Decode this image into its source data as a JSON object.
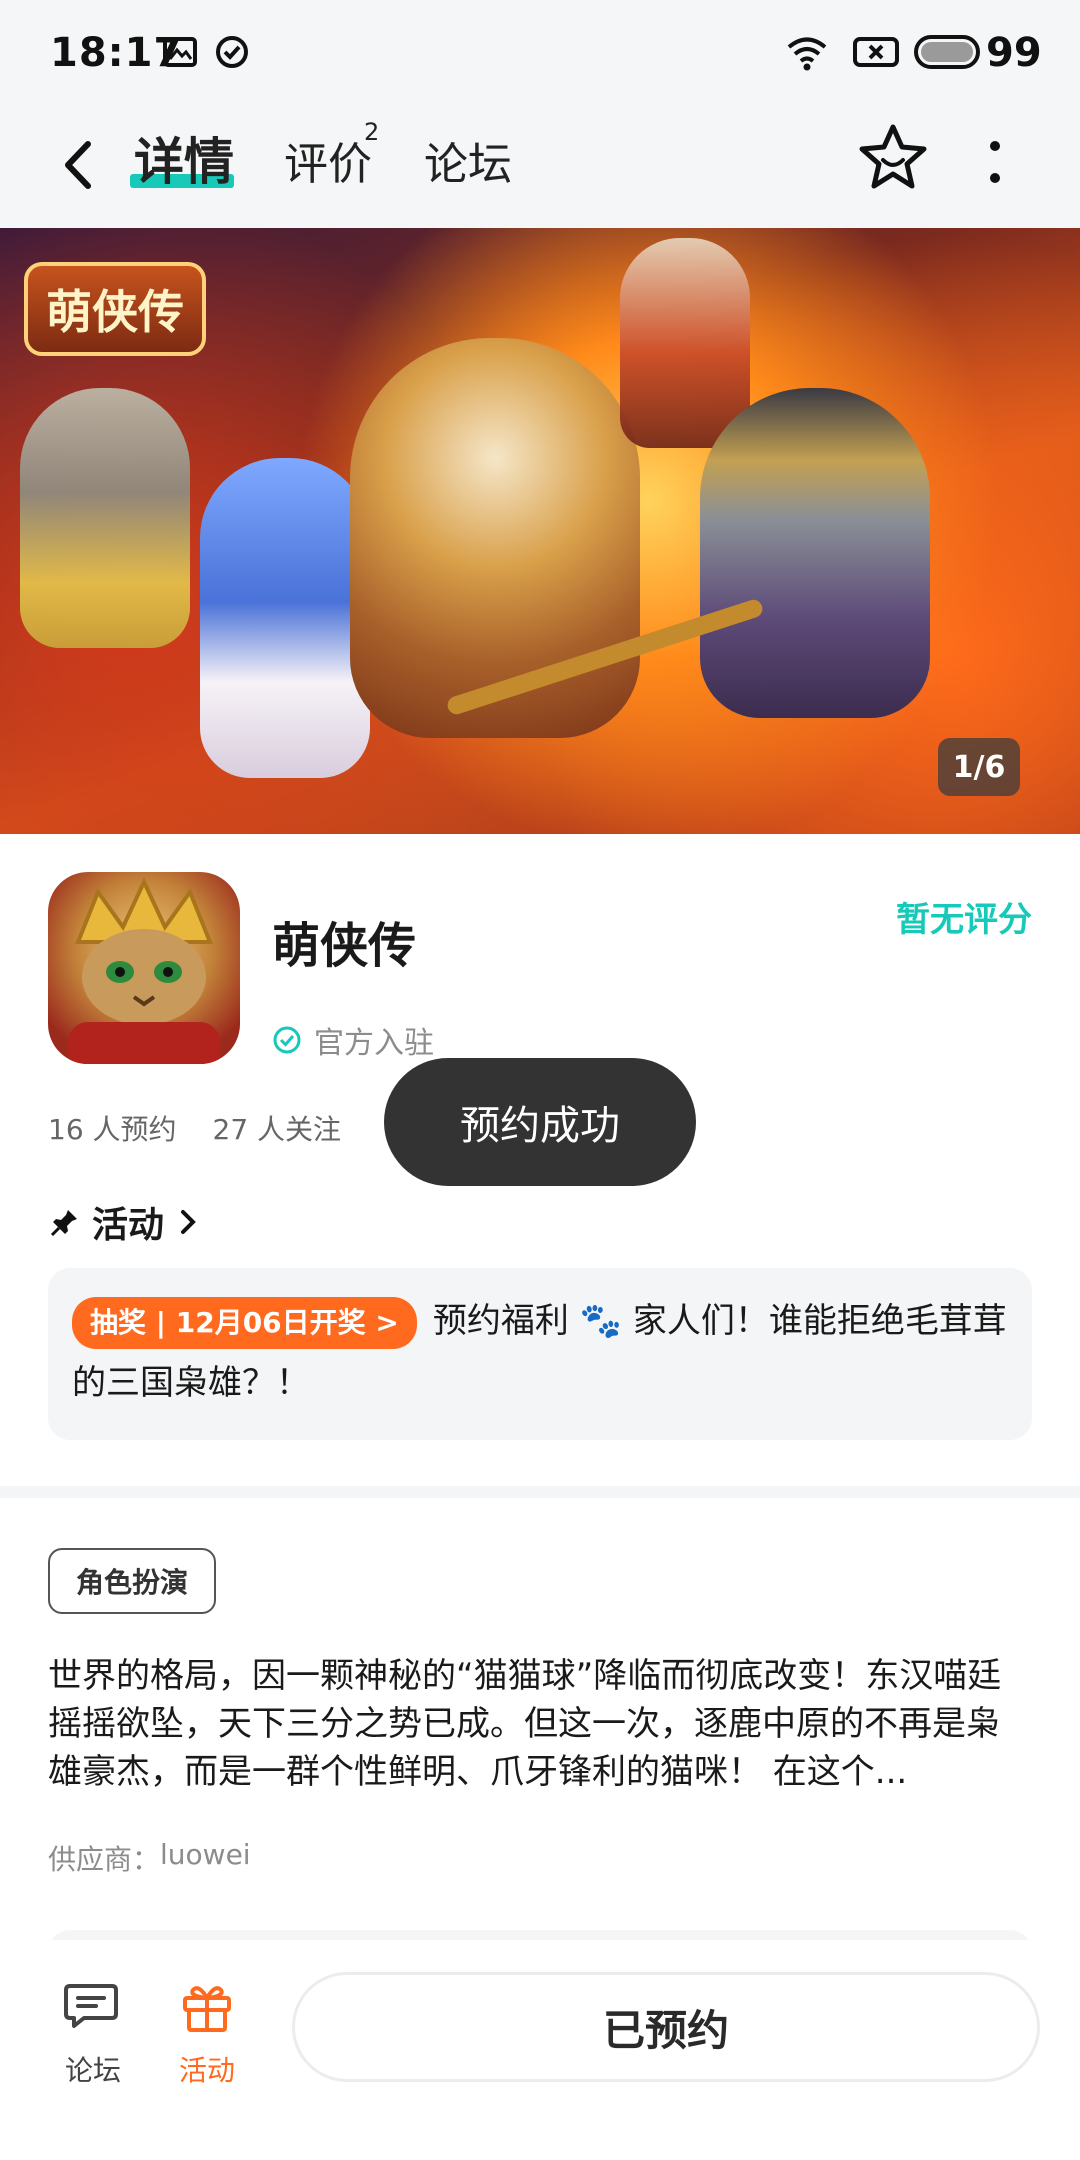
{
  "status_bar": {
    "time": "18:17",
    "battery": "99"
  },
  "header": {
    "tabs": [
      {
        "label": "详情",
        "active": true
      },
      {
        "label": "评价",
        "sup": "2"
      },
      {
        "label": "论坛"
      }
    ]
  },
  "banner": {
    "logo_text": "萌侠传",
    "counter": "1/6"
  },
  "app": {
    "name": "萌侠传",
    "rating": "暂无评分",
    "official": "官方入驻",
    "reservations": "16 人预约",
    "followers": "27 人关注"
  },
  "toast": {
    "text": "预约成功"
  },
  "activity": {
    "title": "活动",
    "badge": "抽奖 | 12月06日开奖 >",
    "text": "预约福利 🐾 家人们！谁能拒绝毛茸茸的三国枭雄？！"
  },
  "tag": "角色扮演",
  "description": "世界的格局，因一颗神秘的“猫猫球”降临而彻底改变！东汉喵廷摇摇欲坠，天下三分之势已成。但这一次，逐鹿中原的不再是枭雄豪杰，而是一群个性鲜明、爪牙锋利的猫咪！ 在这个...",
  "supplier": {
    "label": "供应商：",
    "value": "luowei"
  },
  "bottom": {
    "forum": "论坛",
    "activity": "活动",
    "reserve_button": "已预约"
  },
  "colors": {
    "accent_teal": "#16c9b8",
    "accent_orange": "#ff6a1f",
    "toast_bg": "#333333"
  }
}
